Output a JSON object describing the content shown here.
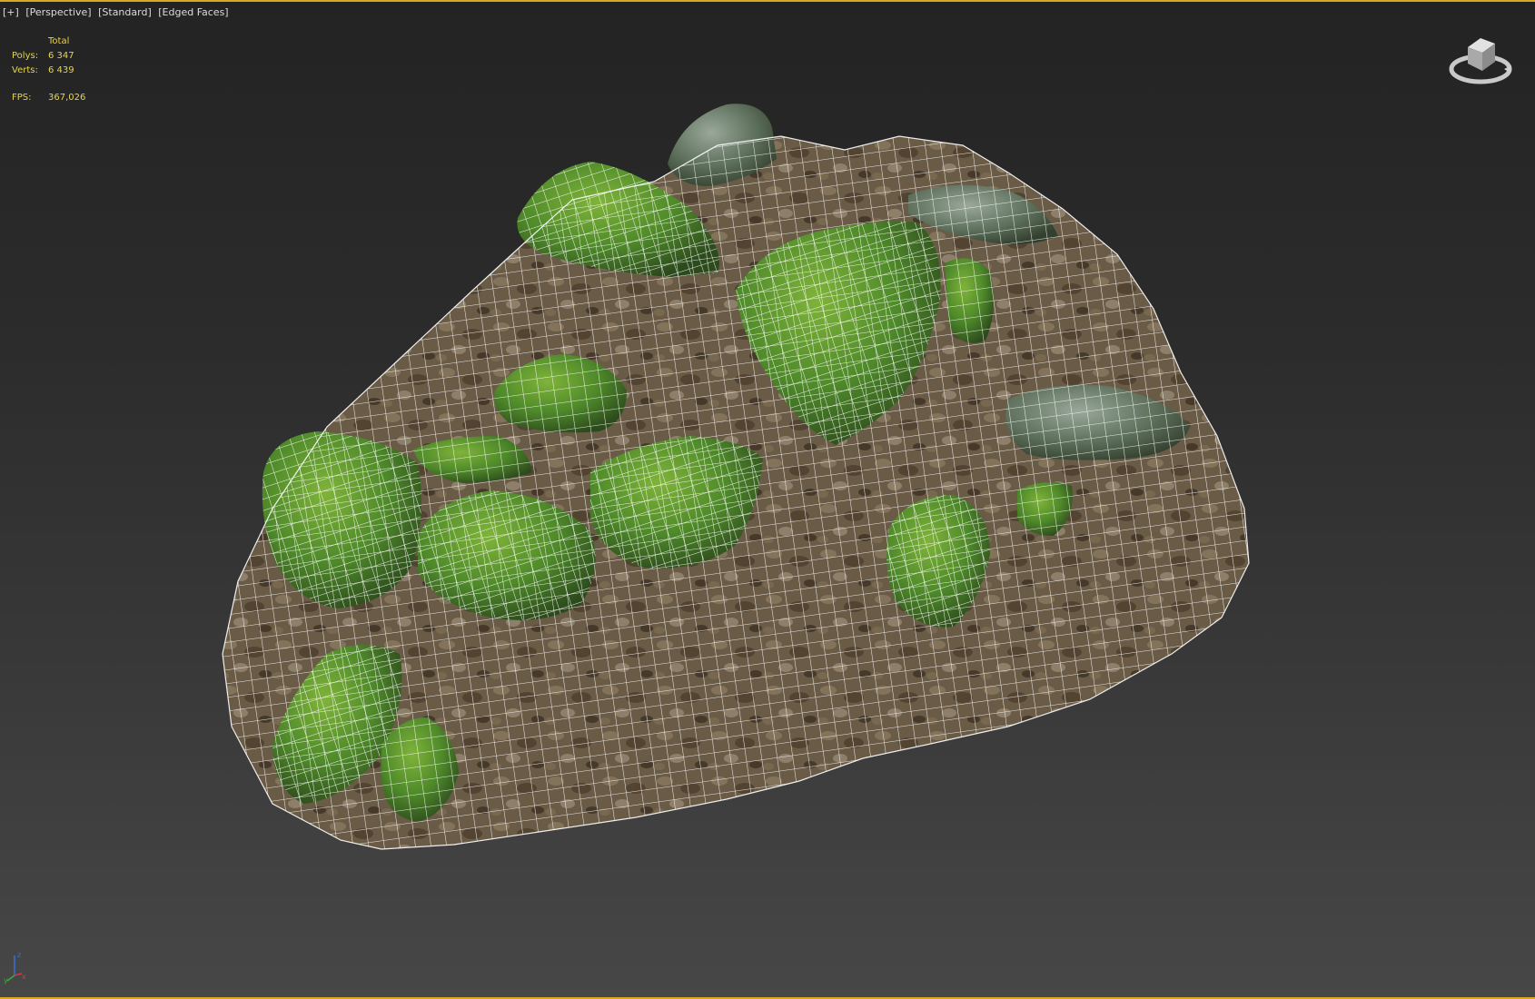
{
  "viewport": {
    "labels": [
      "[+]",
      "[Perspective]",
      "[Standard]",
      "[Edged Faces]"
    ],
    "stats_header": "Total",
    "stats": [
      {
        "label": "Polys:",
        "value": "6 347"
      },
      {
        "label": "Verts:",
        "value": "6 439"
      }
    ],
    "fps": {
      "label": "FPS:",
      "value": "367,026"
    }
  },
  "colors": {
    "active_border": "#d9a81e",
    "stats_text": "#e6d44c",
    "label_text": "#dcdcdc",
    "background_top": "#232323",
    "background_bottom": "#474747",
    "moss": "#4f8a2a",
    "ground": "#7a6a52",
    "wire": "#ffffff"
  },
  "icons": {
    "viewcube": "viewcube-icon",
    "axis": "axis-tripod-icon"
  },
  "axis_labels": {
    "x": "x",
    "y": "y",
    "z": "z"
  }
}
